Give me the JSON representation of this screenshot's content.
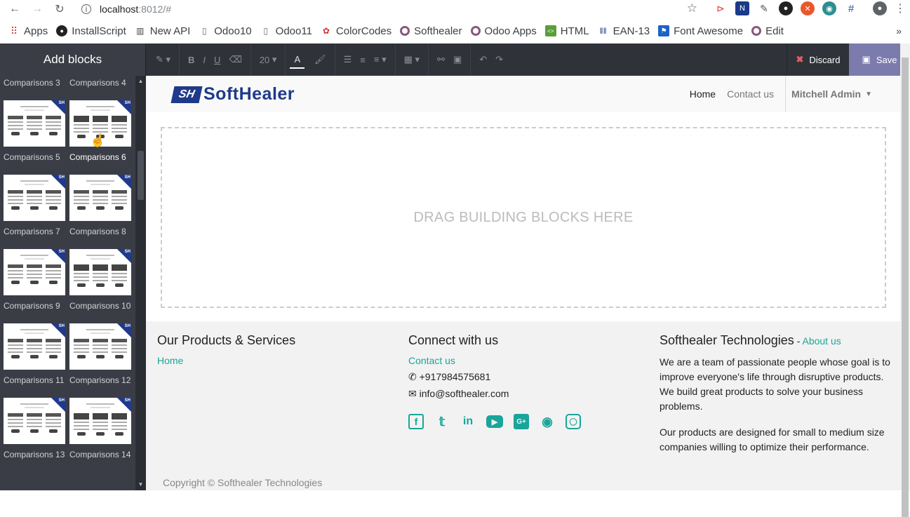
{
  "browser": {
    "url_host": "localhost",
    "url_port": ":8012/#",
    "bookmarks": [
      {
        "label": "Apps",
        "icon": "apps-grid-icon"
      },
      {
        "label": "InstallScript",
        "icon": "github-icon"
      },
      {
        "label": "New API",
        "icon": "book-icon"
      },
      {
        "label": "Odoo10",
        "icon": "page-icon"
      },
      {
        "label": "Odoo11",
        "icon": "page-icon"
      },
      {
        "label": "ColorCodes",
        "icon": "color-icon"
      },
      {
        "label": "Softhealer",
        "icon": "odoo-icon"
      },
      {
        "label": "Odoo Apps",
        "icon": "odoo-icon"
      },
      {
        "label": "HTML",
        "icon": "html-icon"
      },
      {
        "label": "EAN-13",
        "icon": "barcode-icon"
      },
      {
        "label": "Font Awesome",
        "icon": "flag-icon"
      },
      {
        "label": "Edit",
        "icon": "odoo-icon"
      }
    ]
  },
  "editor": {
    "sidebar_title": "Add blocks",
    "font_size": "20",
    "discard_label": "Discard",
    "save_label": "Save"
  },
  "snippets": [
    {
      "label": "Comparisons 3"
    },
    {
      "label": "Comparisons 4"
    },
    {
      "label": "Comparisons 5"
    },
    {
      "label": "Comparisons 6"
    },
    {
      "label": "Comparisons 7"
    },
    {
      "label": "Comparisons 8"
    },
    {
      "label": "Comparisons 9"
    },
    {
      "label": "Comparisons 10"
    },
    {
      "label": "Comparisons 11"
    },
    {
      "label": "Comparisons 12"
    },
    {
      "label": "Comparisons 13"
    },
    {
      "label": "Comparisons 14"
    }
  ],
  "site": {
    "logo_text": "SoftHealer",
    "logo_mark": "SH",
    "nav": [
      "Home",
      "Contact us"
    ],
    "user": "Mitchell Admin",
    "drop_text": "DRAG BUILDING BLOCKS HERE"
  },
  "footer": {
    "col1_title": "Our Products & Services",
    "col1_link": "Home",
    "col2_title": "Connect with us",
    "col2_link": "Contact us",
    "phone": "+917984575681",
    "email": "info@softhealer.com",
    "col3_title": "Softhealer Technologies",
    "col3_sep": " - ",
    "col3_link": "About us",
    "para1": "We are a team of passionate people whose goal is to improve everyone's life through disruptive products. We build great products to solve your business problems.",
    "para2": "Our products are designed for small to medium size companies willing to optimize their performance.",
    "copyright": "Copyright © Softhealer Technologies"
  },
  "colors": {
    "accent": "#1aa59a",
    "brand": "#1f3a8a",
    "save": "#7c7bad",
    "editor_bar": "#2f3239"
  }
}
